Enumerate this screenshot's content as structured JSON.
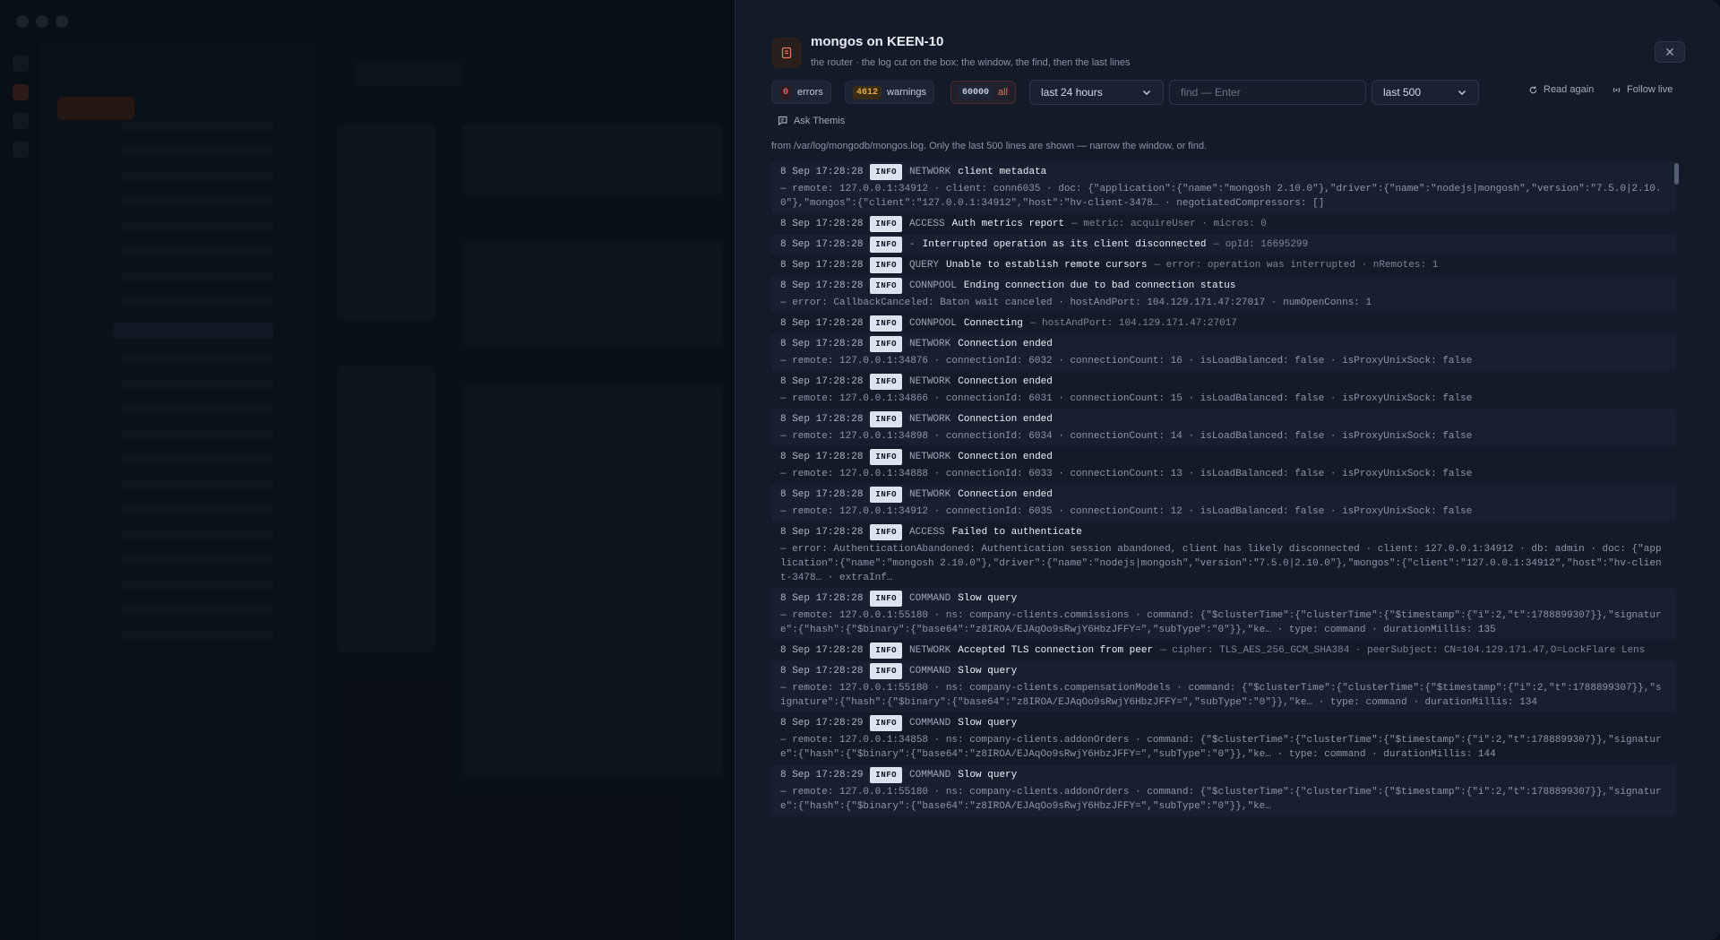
{
  "panel": {
    "title": "mongos on KEEN-10",
    "subtitle": "the router · the log cut on the box: the window, the find, then the last lines",
    "close_label": "✕"
  },
  "toolbar": {
    "errors_count": "0",
    "errors_label": "errors",
    "warnings_count": "4612",
    "warnings_label": "warnings",
    "all_count": "60000",
    "all_label": "all",
    "window_value": "last 24 hours",
    "find_placeholder": "find — Enter",
    "lines_value": "last 500",
    "read_again_label": "Read again",
    "follow_live_label": "Follow live",
    "ask_label": "Ask Themis"
  },
  "note": "from /var/log/mongodb/mongos.log. Only the last 500 lines are shown — narrow the window, or find.",
  "logs": [
    {
      "ts": "8 Sep 17:28:28",
      "level": "INFO",
      "comp": "NETWORK",
      "msg": "client metadata",
      "extra": "",
      "attrs": "— remote: 127.0.0.1:34912 · client: conn6035 · doc: {\"application\":{\"name\":\"mongosh 2.10.0\"},\"driver\":{\"name\":\"nodejs|mongosh\",\"version\":\"7.5.0|2.10.0\"},\"mongos\":{\"client\":\"127.0.0.1:34912\",\"host\":\"hv-client-3478… · negotiatedCompressors: []"
    },
    {
      "ts": "8 Sep 17:28:28",
      "level": "INFO",
      "comp": "ACCESS",
      "msg": "Auth metrics report",
      "extra": "— metric: acquireUser · micros: 0",
      "attrs": ""
    },
    {
      "ts": "8 Sep 17:28:28",
      "level": "INFO",
      "comp": "-",
      "msg": "Interrupted operation as its client disconnected",
      "extra": "— opId: 16695299",
      "attrs": ""
    },
    {
      "ts": "8 Sep 17:28:28",
      "level": "INFO",
      "comp": "QUERY",
      "msg": "Unable to establish remote cursors",
      "extra": "— error: operation was interrupted · nRemotes: 1",
      "attrs": ""
    },
    {
      "ts": "8 Sep 17:28:28",
      "level": "INFO",
      "comp": "CONNPOOL",
      "msg": "Ending connection due to bad connection status",
      "extra": "",
      "attrs": "— error: CallbackCanceled: Baton wait canceled · hostAndPort: 104.129.171.47:27017 · numOpenConns: 1"
    },
    {
      "ts": "8 Sep 17:28:28",
      "level": "INFO",
      "comp": "CONNPOOL",
      "msg": "Connecting",
      "extra": "— hostAndPort: 104.129.171.47:27017",
      "attrs": ""
    },
    {
      "ts": "8 Sep 17:28:28",
      "level": "INFO",
      "comp": "NETWORK",
      "msg": "Connection ended",
      "extra": "",
      "attrs": "— remote: 127.0.0.1:34876 · connectionId: 6032 · connectionCount: 16 · isLoadBalanced: false · isProxyUnixSock: false"
    },
    {
      "ts": "8 Sep 17:28:28",
      "level": "INFO",
      "comp": "NETWORK",
      "msg": "Connection ended",
      "extra": "",
      "attrs": "— remote: 127.0.0.1:34866 · connectionId: 6031 · connectionCount: 15 · isLoadBalanced: false · isProxyUnixSock: false"
    },
    {
      "ts": "8 Sep 17:28:28",
      "level": "INFO",
      "comp": "NETWORK",
      "msg": "Connection ended",
      "extra": "",
      "attrs": "— remote: 127.0.0.1:34898 · connectionId: 6034 · connectionCount: 14 · isLoadBalanced: false · isProxyUnixSock: false"
    },
    {
      "ts": "8 Sep 17:28:28",
      "level": "INFO",
      "comp": "NETWORK",
      "msg": "Connection ended",
      "extra": "",
      "attrs": "— remote: 127.0.0.1:34888 · connectionId: 6033 · connectionCount: 13 · isLoadBalanced: false · isProxyUnixSock: false"
    },
    {
      "ts": "8 Sep 17:28:28",
      "level": "INFO",
      "comp": "NETWORK",
      "msg": "Connection ended",
      "extra": "",
      "attrs": "— remote: 127.0.0.1:34912 · connectionId: 6035 · connectionCount: 12 · isLoadBalanced: false · isProxyUnixSock: false"
    },
    {
      "ts": "8 Sep 17:28:28",
      "level": "INFO",
      "comp": "ACCESS",
      "msg": "Failed to authenticate",
      "extra": "",
      "attrs": "— error: AuthenticationAbandoned: Authentication session abandoned, client has likely disconnected · client: 127.0.0.1:34912 · db: admin · doc: {\"application\":{\"name\":\"mongosh 2.10.0\"},\"driver\":{\"name\":\"nodejs|mongosh\",\"version\":\"7.5.0|2.10.0\"},\"mongos\":{\"client\":\"127.0.0.1:34912\",\"host\":\"hv-client-3478… · extraInf…"
    },
    {
      "ts": "8 Sep 17:28:28",
      "level": "INFO",
      "comp": "COMMAND",
      "msg": "Slow query",
      "extra": "",
      "attrs": "— remote: 127.0.0.1:55180 · ns: company-clients.commissions · command: {\"$clusterTime\":{\"clusterTime\":{\"$timestamp\":{\"i\":2,\"t\":1788899307}},\"signature\":{\"hash\":{\"$binary\":{\"base64\":\"z8IROA/EJAqOo9sRwjY6HbzJFFY=\",\"subType\":\"0\"}},\"ke… · type: command · durationMillis: 135"
    },
    {
      "ts": "8 Sep 17:28:28",
      "level": "INFO",
      "comp": "NETWORK",
      "msg": "Accepted TLS connection from peer",
      "extra": "— cipher: TLS_AES_256_GCM_SHA384 · peerSubject: CN=104.129.171.47,O=LockFlare Lens",
      "attrs": ""
    },
    {
      "ts": "8 Sep 17:28:28",
      "level": "INFO",
      "comp": "COMMAND",
      "msg": "Slow query",
      "extra": "",
      "attrs": "— remote: 127.0.0.1:55180 · ns: company-clients.compensationModels · command: {\"$clusterTime\":{\"clusterTime\":{\"$timestamp\":{\"i\":2,\"t\":1788899307}},\"signature\":{\"hash\":{\"$binary\":{\"base64\":\"z8IROA/EJAqOo9sRwjY6HbzJFFY=\",\"subType\":\"0\"}},\"ke… · type: command · durationMillis: 134"
    },
    {
      "ts": "8 Sep 17:28:29",
      "level": "INFO",
      "comp": "COMMAND",
      "msg": "Slow query",
      "extra": "",
      "attrs": "— remote: 127.0.0.1:34858 · ns: company-clients.addonOrders · command: {\"$clusterTime\":{\"clusterTime\":{\"$timestamp\":{\"i\":2,\"t\":1788899307}},\"signature\":{\"hash\":{\"$binary\":{\"base64\":\"z8IROA/EJAqOo9sRwjY6HbzJFFY=\",\"subType\":\"0\"}},\"ke… · type: command · durationMillis: 144"
    },
    {
      "ts": "8 Sep 17:28:29",
      "level": "INFO",
      "comp": "COMMAND",
      "msg": "Slow query",
      "extra": "",
      "attrs": "— remote: 127.0.0.1:55180 · ns: company-clients.addonOrders · command: {\"$clusterTime\":{\"clusterTime\":{\"$timestamp\":{\"i\":2,\"t\":1788899307}},\"signature\":{\"hash\":{\"$binary\":{\"base64\":\"z8IROA/EJAqOo9sRwjY6HbzJFFY=\",\"subType\":\"0\"}},\"ke…"
    }
  ],
  "colors": {
    "panel_bg": "#131b29",
    "accent": "#e07a5f",
    "error": "#e26c6c",
    "warning": "#e3ab4d"
  }
}
